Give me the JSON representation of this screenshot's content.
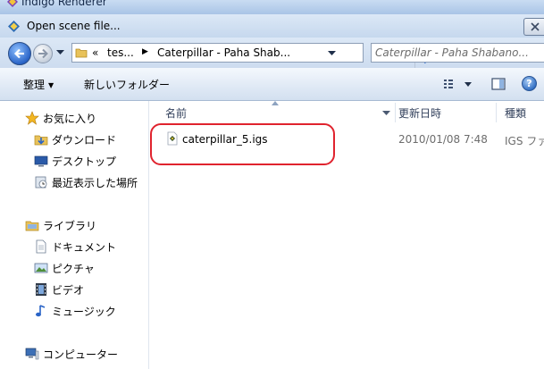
{
  "app": {
    "title": "Indigo Renderer"
  },
  "dialog": {
    "title": "Open scene file..."
  },
  "address": {
    "overflow": "«",
    "crumbs": [
      "tes...",
      "Caterpillar - Paha Shab..."
    ]
  },
  "search": {
    "placeholder": "Caterpillar - Paha Shabano..."
  },
  "toolbar": {
    "organize_label": "整理",
    "new_folder_label": "新しいフォルダー",
    "help_label": "?"
  },
  "sidebar": {
    "favorites": {
      "label": "お気に入り",
      "items": [
        {
          "label": "ダウンロード",
          "icon": "download-folder-icon"
        },
        {
          "label": "デスクトップ",
          "icon": "desktop-icon"
        },
        {
          "label": "最近表示した場所",
          "icon": "recent-places-icon"
        }
      ]
    },
    "libraries": {
      "label": "ライブラリ",
      "items": [
        {
          "label": "ドキュメント",
          "icon": "documents-icon"
        },
        {
          "label": "ピクチャ",
          "icon": "pictures-icon"
        },
        {
          "label": "ビデオ",
          "icon": "videos-icon"
        },
        {
          "label": "ミュージック",
          "icon": "music-icon"
        }
      ]
    },
    "computer": {
      "label": "コンピューター",
      "icon": "computer-icon"
    }
  },
  "list": {
    "columns": {
      "name": "名前",
      "modified": "更新日時",
      "type": "種類"
    },
    "rows": [
      {
        "name": "caterpillar_5.igs",
        "modified": "2010/01/08 7:48",
        "type": "IGS ファ"
      }
    ]
  },
  "colors": {
    "highlight": "#e0232e",
    "accent": "#2a64c7"
  }
}
